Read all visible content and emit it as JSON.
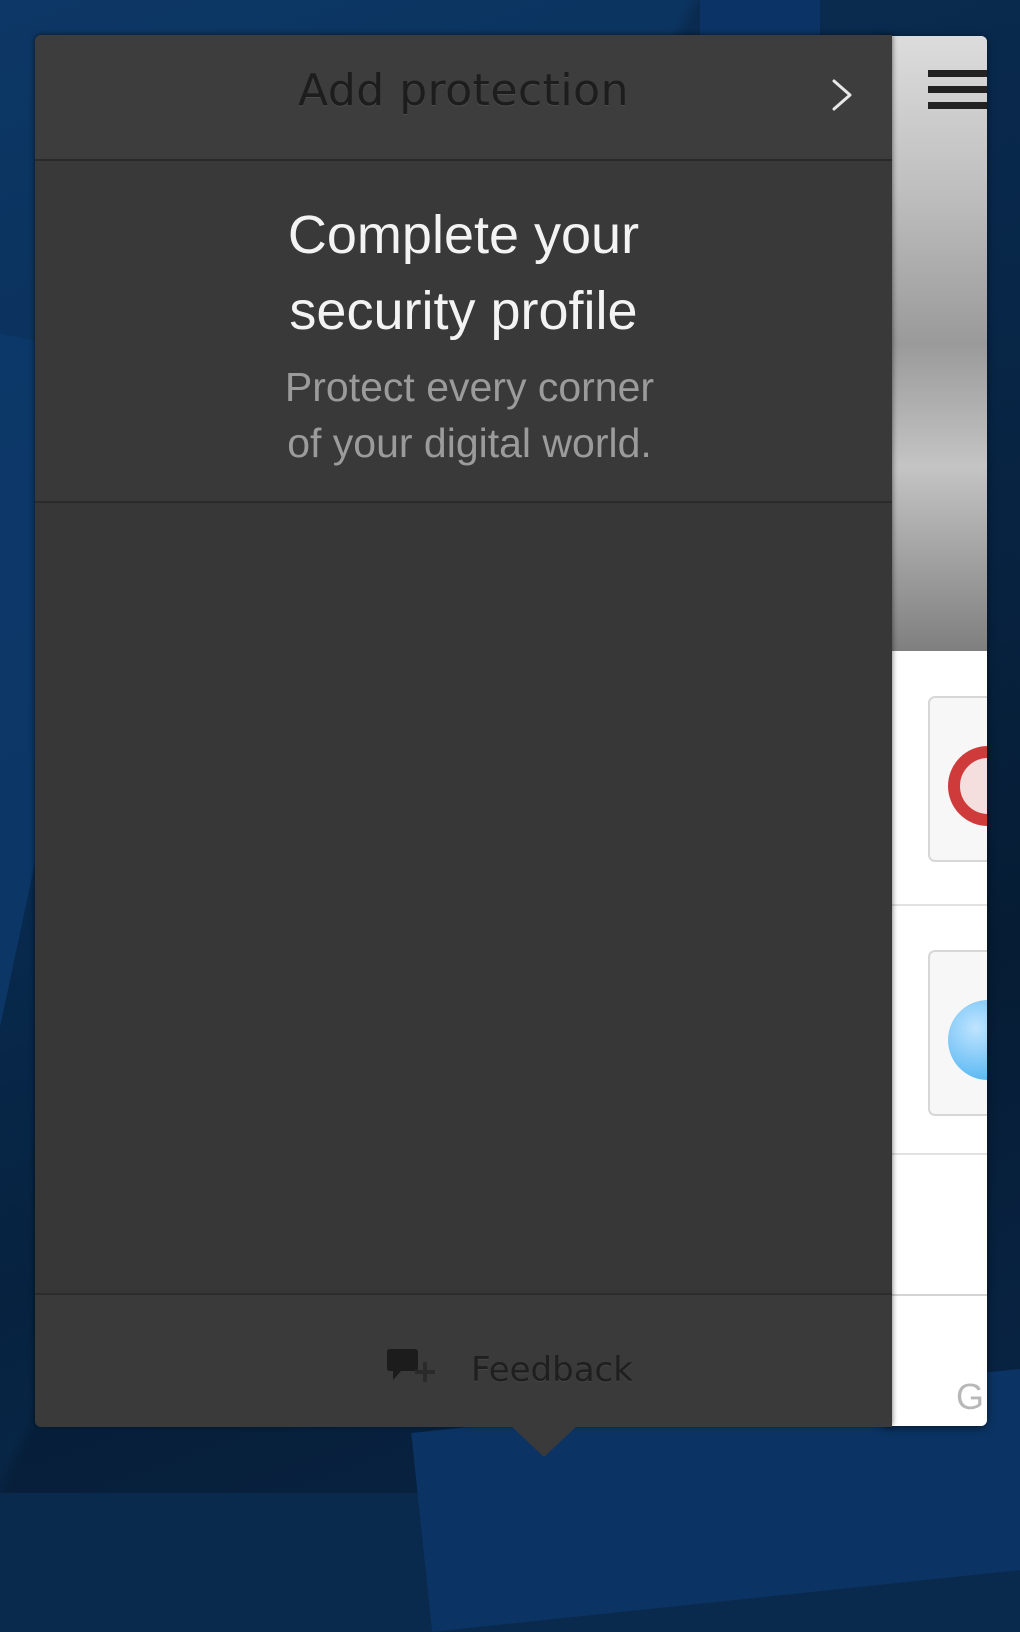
{
  "header": {
    "title": "Add protection",
    "next_icon": "chevron-right-icon"
  },
  "intro": {
    "title": "Complete your\nsecurity profile",
    "subtitle": "Protect every corner\nof your digital world."
  },
  "footer": {
    "feedback_label": "Feedback",
    "feedback_icon": "feedback-add-icon"
  },
  "side_panel": {
    "menu_icon": "hamburger-menu-icon",
    "footer_text": "G"
  },
  "colors": {
    "popup_bg": "#3a3a3a",
    "title_text": "#f3f3f3",
    "subtitle_text": "#9b9b9b",
    "header_text": "#1d1d1d"
  }
}
